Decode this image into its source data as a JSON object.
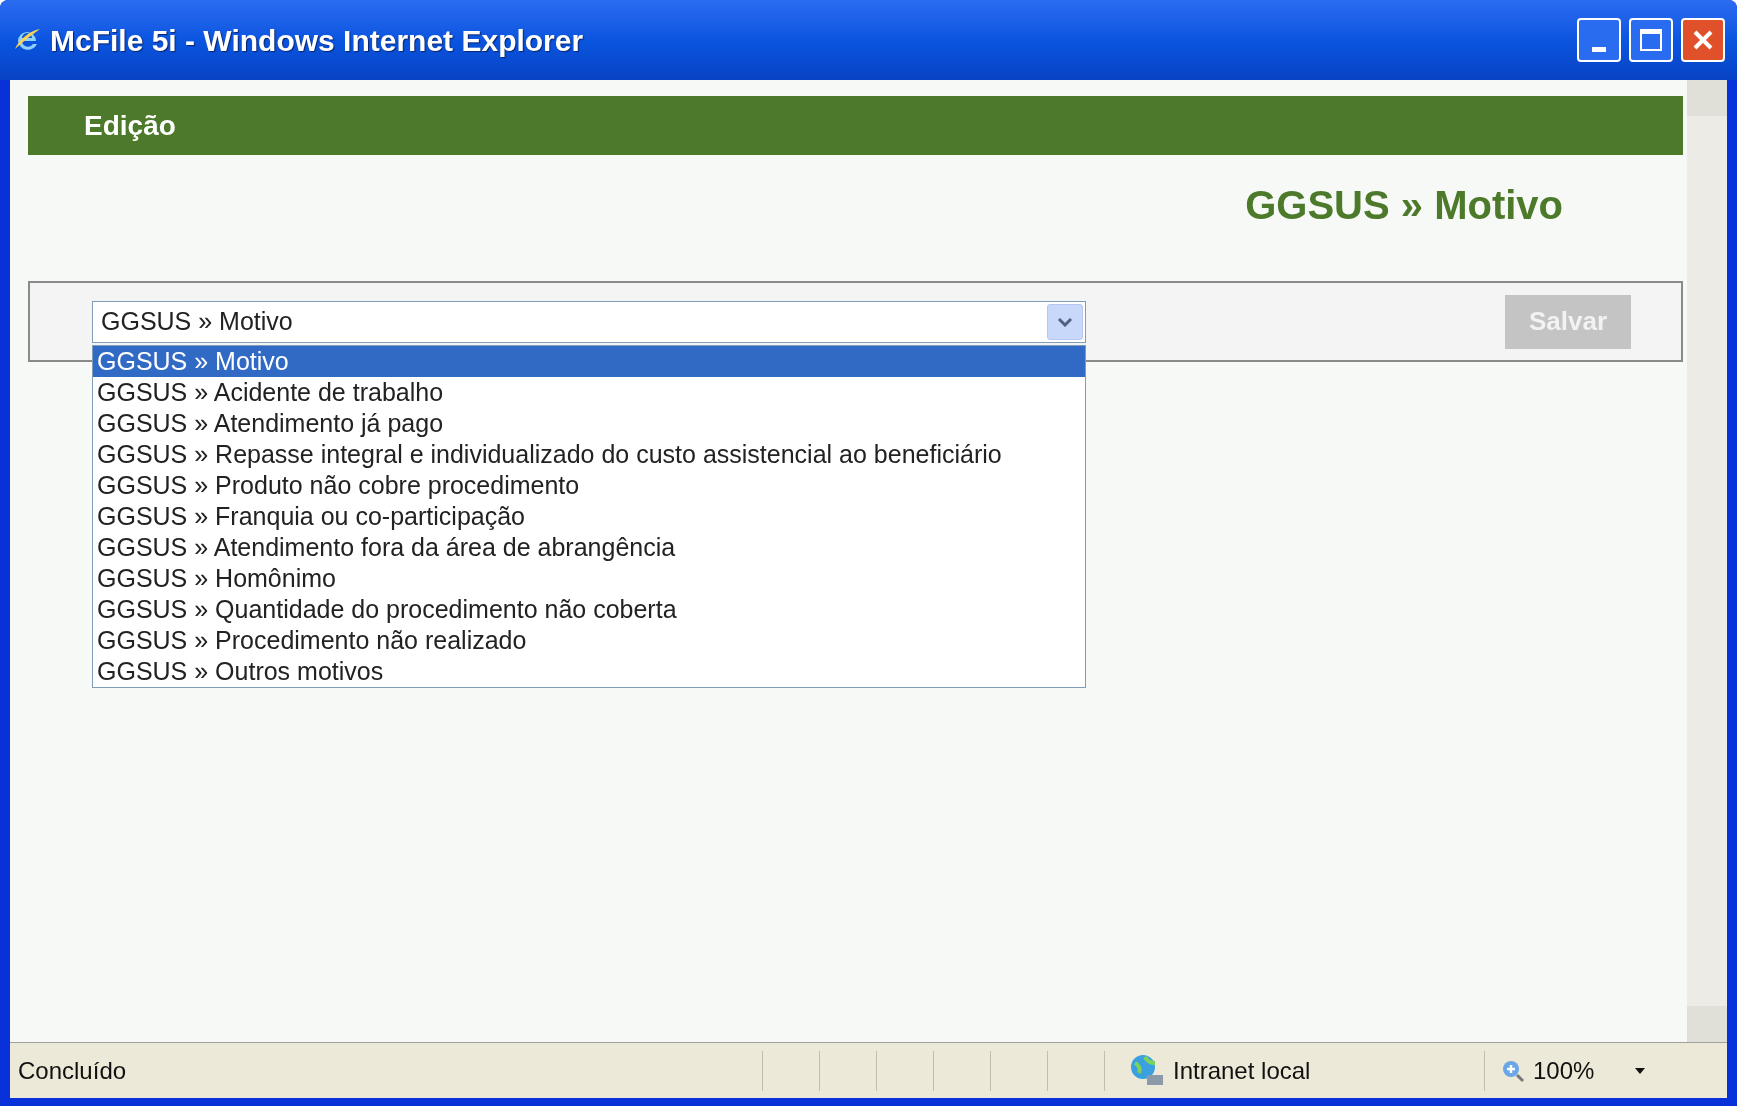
{
  "window": {
    "title": "McFile 5i - Windows Internet Explorer"
  },
  "header": {
    "title": "Edição"
  },
  "page_title": "GGSUS » Motivo",
  "select": {
    "value": "GGSUS » Motivo",
    "expanded": true,
    "options": [
      {
        "label": "GGSUS » Motivo",
        "selected": true
      },
      {
        "label": "GGSUS » Acidente de trabalho",
        "selected": false
      },
      {
        "label": "GGSUS » Atendimento já pago",
        "selected": false
      },
      {
        "label": "GGSUS » Repasse integral e individualizado do custo assistencial ao beneficiário",
        "selected": false
      },
      {
        "label": "GGSUS » Produto não cobre procedimento",
        "selected": false
      },
      {
        "label": "GGSUS » Franquia ou co-participação",
        "selected": false
      },
      {
        "label": "GGSUS » Atendimento fora da área de abrangência",
        "selected": false
      },
      {
        "label": "GGSUS » Homônimo",
        "selected": false
      },
      {
        "label": "GGSUS » Quantidade do procedimento não coberta",
        "selected": false
      },
      {
        "label": "GGSUS » Procedimento não realizado",
        "selected": false
      },
      {
        "label": "GGSUS » Outros motivos",
        "selected": false
      }
    ]
  },
  "save_button": {
    "label": "Salvar",
    "disabled": true
  },
  "status_bar": {
    "status": "Concluído",
    "zone": "Intranet local",
    "zoom": "100%"
  }
}
